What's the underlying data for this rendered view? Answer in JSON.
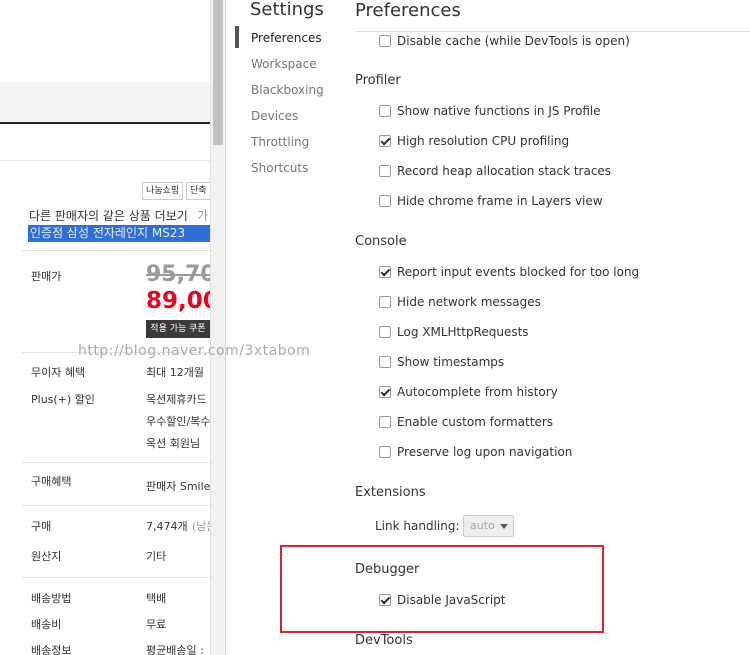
{
  "shop": {
    "tags": [
      "나눔쇼핑",
      "단축"
    ],
    "compare_link": "다른 판매자의 같은 상품 더보기",
    "compare_hint": "가",
    "product_title_selected": "인증점 삼성 전자레인지 MS23",
    "price_label": "판매가",
    "price_original": "95,70",
    "price_sale": "89,00",
    "coupon_label": "적용 가능 쿠폰",
    "rows": [
      {
        "label": "무이자 혜택",
        "value": "최대 12개월"
      },
      {
        "label": "Plus(+) 할인",
        "value": "옥션제휴카드"
      },
      {
        "label": "",
        "value": "우수할인/복수"
      },
      {
        "label": "",
        "value": "옥션 회원님"
      },
      {
        "label": "구매혜택",
        "value": "판매자 Smile"
      },
      {
        "label": "구매",
        "value": "7,474개",
        "extra": "(남은"
      },
      {
        "label": "원산지",
        "value": "기타"
      },
      {
        "label": "배송방법",
        "value": "택배"
      },
      {
        "label": "배송비",
        "value": "무료"
      },
      {
        "label": "배송정보",
        "value": "평균배송일 :"
      }
    ]
  },
  "watermark": "http://blog.naver.com/3xtabom",
  "settings": {
    "title": "Settings",
    "nav": [
      "Preferences",
      "Workspace",
      "Blackboxing",
      "Devices",
      "Throttling",
      "Shortcuts"
    ],
    "active_index": 0
  },
  "preferences": {
    "title": "Preferences",
    "top_option": {
      "label": "Disable cache (while DevTools is open)",
      "checked": false
    },
    "sections": {
      "profiler": {
        "title": "Profiler",
        "options": [
          {
            "label": "Show native functions in JS Profile",
            "checked": false
          },
          {
            "label": "High resolution CPU profiling",
            "checked": true
          },
          {
            "label": "Record heap allocation stack traces",
            "checked": false
          },
          {
            "label": "Hide chrome frame in Layers view",
            "checked": false
          }
        ]
      },
      "console": {
        "title": "Console",
        "options": [
          {
            "label": "Report input events blocked for too long",
            "checked": true
          },
          {
            "label": "Hide network messages",
            "checked": false
          },
          {
            "label": "Log XMLHttpRequests",
            "checked": false
          },
          {
            "label": "Show timestamps",
            "checked": false
          },
          {
            "label": "Autocomplete from history",
            "checked": true
          },
          {
            "label": "Enable custom formatters",
            "checked": false
          },
          {
            "label": "Preserve log upon navigation",
            "checked": false
          }
        ]
      },
      "extensions": {
        "title": "Extensions",
        "link_handling_label": "Link handling:",
        "link_handling_value": "auto"
      },
      "debugger": {
        "title": "Debugger",
        "options": [
          {
            "label": "Disable JavaScript",
            "checked": true
          }
        ]
      },
      "devtools": {
        "title": "DevTools"
      }
    }
  },
  "colors": {
    "highlight_box": "#d9232e",
    "sale_price": "#e3061f",
    "selection": "#2f6fd6"
  }
}
